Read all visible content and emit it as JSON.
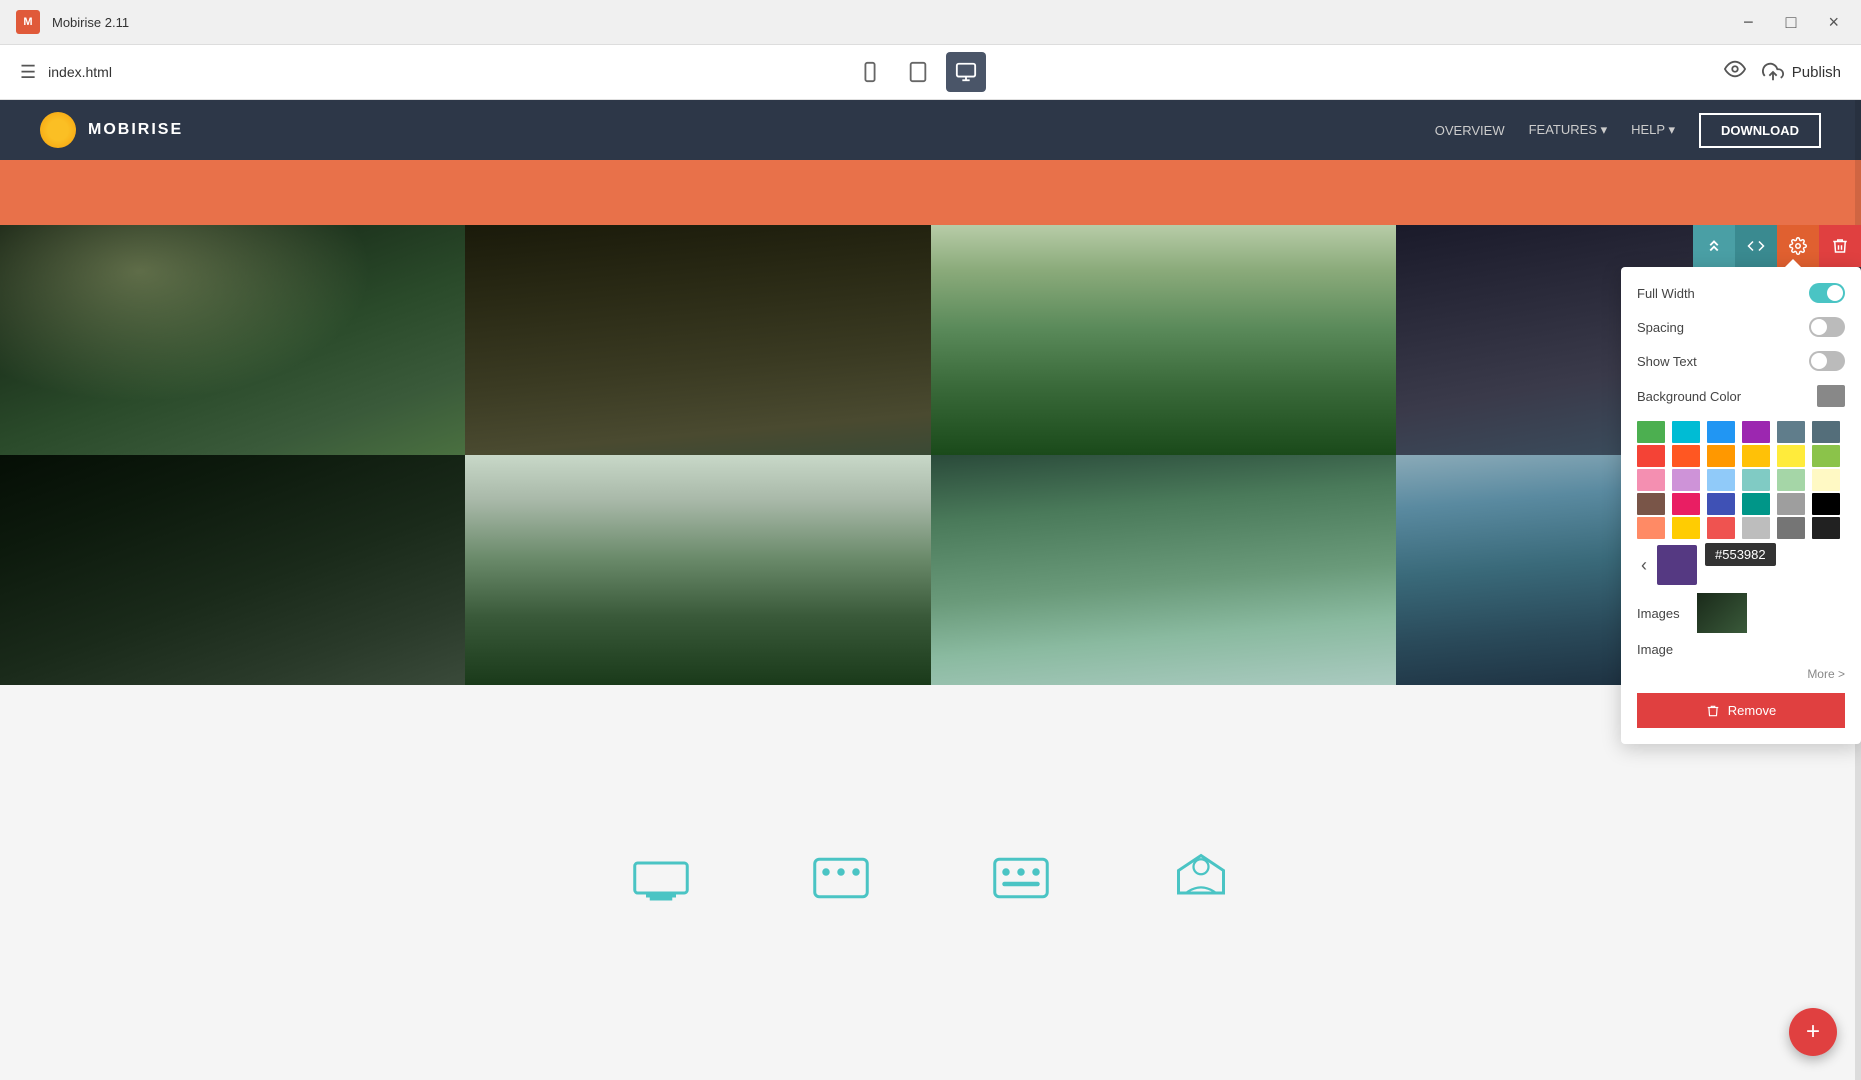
{
  "titlebar": {
    "app_name": "Mobirise 2.11",
    "logo_text": "M",
    "minimize_label": "−",
    "maximize_label": "□",
    "close_label": "×"
  },
  "toolbar": {
    "hamburger": "☰",
    "filename": "index.html",
    "devices": [
      {
        "id": "mobile",
        "icon": "📱",
        "active": false
      },
      {
        "id": "tablet",
        "icon": "⊡",
        "active": false
      },
      {
        "id": "desktop",
        "icon": "🖥",
        "active": true
      }
    ],
    "preview_icon": "👁",
    "publish_icon": "☁",
    "publish_label": "Publish"
  },
  "navbar": {
    "brand_name": "MOBIRISE",
    "nav_items": [
      "OVERVIEW",
      "FEATURES ▾",
      "HELP ▾"
    ],
    "cta_label": "DOWNLOAD"
  },
  "block_toolbar": {
    "reorder_icon": "↕",
    "code_icon": "</>",
    "settings_icon": "⚙",
    "delete_icon": "🗑"
  },
  "settings_panel": {
    "full_width_label": "Full Width",
    "full_width_on": true,
    "spacing_label": "Spacing",
    "spacing_on": false,
    "show_text_label": "Show Text",
    "show_text_on": false,
    "bg_color_label": "Background Color",
    "images_label": "Images",
    "image_label": "Image",
    "color_hex": "#553982",
    "more_label": "More >",
    "remove_label": "Remove",
    "colors": [
      "#4caf50",
      "#00bcd4",
      "#2196f3",
      "#9c27b0",
      "#607d8b",
      "#546e7a",
      "#f44336",
      "#ff5722",
      "#ff9800",
      "#ffc107",
      "#ffeb3b",
      "#8bc34a",
      "#f48fb1",
      "#ce93d8",
      "#90caf9",
      "#80cbc4",
      "#a5d6a7",
      "#fff9c4",
      "#795548",
      "#e91e63",
      "#3f51b5",
      "#009688",
      "#9e9e9e",
      "#000000",
      "#ff8a65",
      "#ffcc02",
      "#ef5350",
      "#bdbdbd",
      "#757575",
      "#212121"
    ]
  },
  "bottom_icons": [
    "⊟",
    "⊞",
    "⊟",
    "⊙"
  ],
  "fab": {
    "label": "+"
  }
}
